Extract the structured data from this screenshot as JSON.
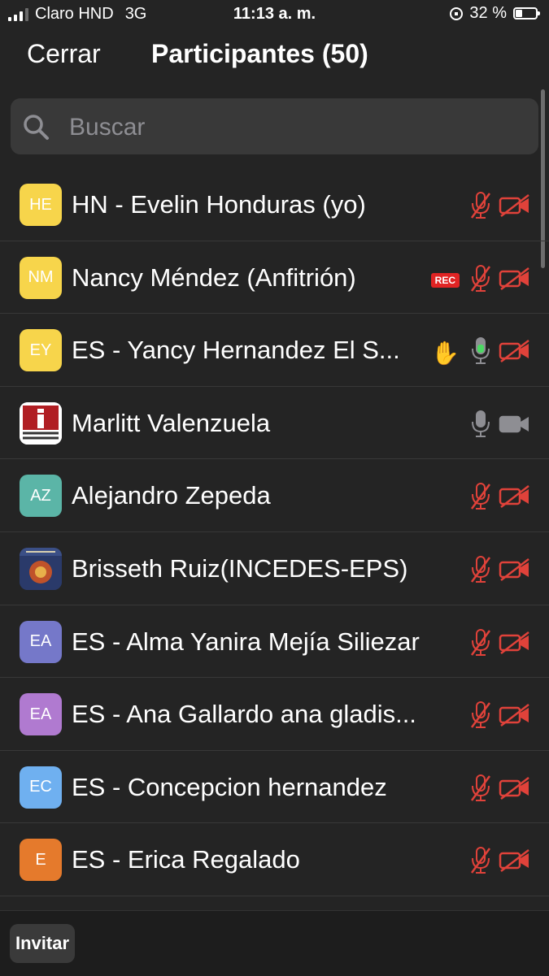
{
  "status_bar": {
    "carrier": "Claro HND",
    "network": "3G",
    "time": "11:13 a. m.",
    "battery": "32 %",
    "battery_level": 0.32
  },
  "header": {
    "close_label": "Cerrar",
    "title": "Participantes (50)"
  },
  "search": {
    "placeholder": "Buscar",
    "value": ""
  },
  "participants": [
    {
      "initials": "HE",
      "name": "HN - Evelin Honduras (yo)",
      "avatar_color": "#f7d54b",
      "mic": "muted",
      "video": "off"
    },
    {
      "initials": "NM",
      "name": "Nancy Méndez (Anfitrión)",
      "avatar_color": "#f7d54b",
      "rec_badge": "REC",
      "mic": "muted",
      "video": "off"
    },
    {
      "initials": "EY",
      "name": "ES - Yancy Hernandez El S...",
      "avatar_color": "#f7d54b",
      "hand": "✋",
      "mic": "active",
      "video": "off"
    },
    {
      "initials": "",
      "name": "Marlitt Valenzuela",
      "avatar_color": "#ffffff",
      "avatar_image": "incedes-logo",
      "mic": "on",
      "video": "on"
    },
    {
      "initials": "AZ",
      "name": "Alejandro Zepeda",
      "avatar_color": "#5bb5a7",
      "mic": "muted",
      "video": "off"
    },
    {
      "initials": "",
      "name": "Brisseth Ruiz(INCEDES-EPS)",
      "avatar_color": "#2a3a6a",
      "avatar_image": "book-cover",
      "mic": "muted",
      "video": "off"
    },
    {
      "initials": "EA",
      "name": "ES - Alma Yanira Mejía Siliezar",
      "avatar_color": "#7578c9",
      "mic": "muted",
      "video": "off"
    },
    {
      "initials": "EA",
      "name": "ES - Ana Gallardo ana gladis...",
      "avatar_color": "#b07ad0",
      "mic": "muted",
      "video": "off"
    },
    {
      "initials": "EC",
      "name": "ES - Concepcion hernandez",
      "avatar_color": "#6fb0f0",
      "mic": "muted",
      "video": "off"
    },
    {
      "initials": "E",
      "name": "ES - Erica Regalado",
      "avatar_color": "#e57a2c",
      "mic": "muted",
      "video": "off"
    }
  ],
  "footer": {
    "invite_label": "Invitar"
  },
  "colors": {
    "background": "#242424",
    "muted_red": "#e0423a",
    "mic_green": "#4cd964",
    "icon_gray": "#8e8e93"
  }
}
